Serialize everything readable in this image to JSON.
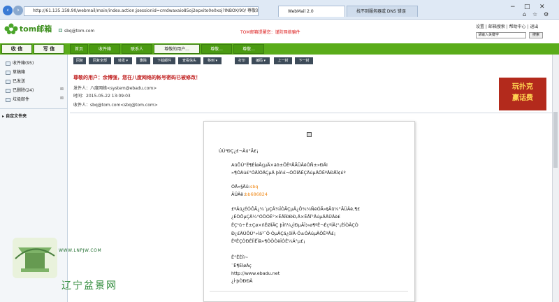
{
  "browser": {
    "url": "http://61.135.158.90/webmail/main/index.action;jsessionid=cmdwaxaio85oj2epxito0e0xoj?INBOX/90/ 尊敬的用户",
    "tabs": [
      "WebMail 2.0",
      "找不到服务器或 DNS 错误"
    ],
    "window_buttons": [
      "−",
      "□",
      "✕",
      "⌂",
      "☆",
      "⚙"
    ]
  },
  "header": {
    "logo": "tom邮箱",
    "user": "sbq@tom.com",
    "notice": "TOM邮箱提醒您：谨防网络骗件",
    "top_links": "设置 | 邮箱搜索 | 帮助中心 | 退出",
    "search_placeholder": "请输入关键字",
    "search_button": "搜索"
  },
  "nav": {
    "receive": "收 信",
    "write": "写 信",
    "tabs": [
      "首页",
      "收件箱",
      "联系人",
      "尊敬的用户...",
      "尊敬...",
      "尊敬..."
    ]
  },
  "sidebar": {
    "folders": [
      {
        "label": "收件箱",
        "count": "(95)"
      },
      {
        "label": "草稿箱",
        "count": ""
      },
      {
        "label": "已发送",
        "count": ""
      },
      {
        "label": "已删除",
        "count": "(24)"
      },
      {
        "label": "垃圾邮件",
        "count": ""
      }
    ],
    "custom_folders": "自定文件夹"
  },
  "toolbar": {
    "buttons": [
      "回复",
      "回复全部",
      "转发 ▾",
      "删除",
      "下载邮件",
      "查看信头",
      "移到 ▾",
      "打印",
      "编码 ▾",
      "上一封",
      "下一封"
    ]
  },
  "message": {
    "subject": "尊敬的用户：余博强，您在八度网络的帐号密码已被修改！",
    "from_label": "发件人：",
    "from": "八度网络<system@ebadu.com>",
    "time_label": "时间：",
    "time": "2015-05-22 13:09:03",
    "to_label": "收件人：",
    "to": "sbq@tom.com<sbq@tom.com>",
    "ad_text": [
      "玩扑克",
      "赢话费"
    ],
    "body": [
      "ÚÚ³ÐÇ¿£¬Äú°Ã£¡",
      "AúÔÚ°Ë¶ÈÍøÂçµÄ×áô±ÕÊºÅÃÜÂëÒÑ±»Ð­ÄI",
      "»¶ÓÀú£°ÓÄÎÓÄÇµÄ þÎñ£¬ÓÖÌÄÊÇÄúµÄÕÊºÅÐÅÏ¢£º",
      "ÓÃ»§Ãû:",
      "sbq",
      "ÃÜÂë:",
      "bb686824",
      "£ºÄú¿ÉÒÔÃ¿¼´µÇÂ¼ÎÒÃÇµÄ¿Õ¾¼ÑéÓÃ»§Ãû¼°ÃÜÂë,¶£",
      "¿ÉÒÔµÇÂ¼°ÓÖÓÊ°×ÊÂÏÐÐÐ,Ä×ÊÂÏ°ÄúµÄÂÜÂë£",
      "ÊÇ¹û÷Ê±Çø×ñÊØÏÂÇ þÎñ¼¿ÌÐµÃ­Î¦»ø¶ºÊ¬ÉçºÍÄ¦°¡ÉÍÒÂÇÒ",
      "Ð¿£ÄÚÔÚ°»Ìá³¯Ö·ÓµÄÇá¿ôÍÃ·Ö±ÓÂúµÄÕÊºÅ£¡",
      "ÊºÊÇÒÐÈÏÌÊÏâ»¶ÓÖÒëÎÒÊ¼Ä°µ£¡",
      "Ê°ËÈÍì~",
      "¨Ë¶ÈÍøÂç",
      "http://www.ebadu.net",
      "¿Í·þÒÐÐÂ"
    ]
  },
  "watermark": {
    "url": "WWW.LNPJW.COM",
    "cn": "辽宁盆景网"
  }
}
